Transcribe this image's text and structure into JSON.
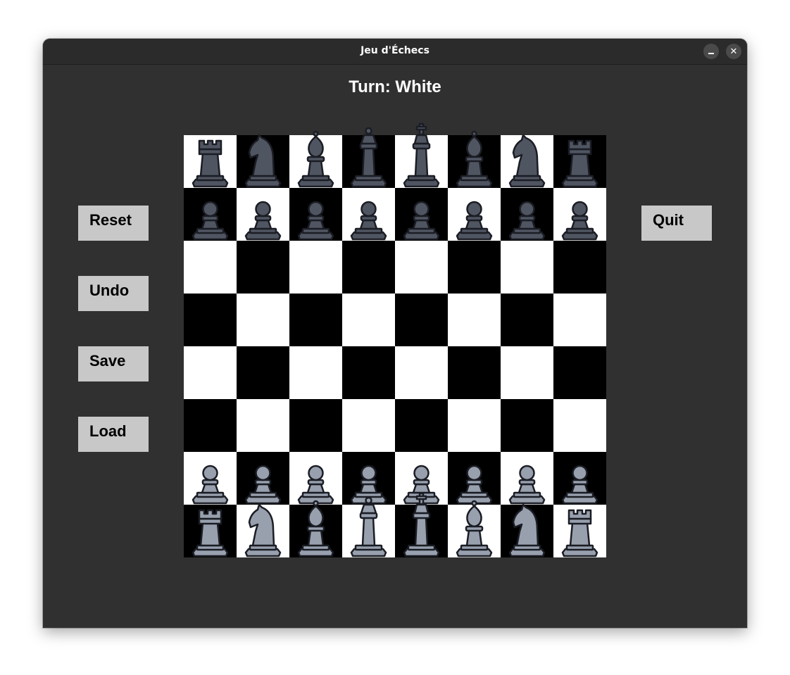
{
  "window": {
    "title": "Jeu d'Échecs",
    "minimize_icon": "minimize-icon",
    "close_icon": "close-icon",
    "close_glyph": "✕"
  },
  "turn_label": "Turn: White",
  "buttons": {
    "reset": "Reset",
    "undo": "Undo",
    "save": "Save",
    "load": "Load",
    "quit": "Quit"
  },
  "board": {
    "light_color": "#ffffff",
    "dark_color": "#000000",
    "black_piece_color": "#505562",
    "white_piece_color": "#98a0ae",
    "ranks": [
      [
        "bR",
        "bN",
        "bB",
        "bQ",
        "bK",
        "bB",
        "bN",
        "bR"
      ],
      [
        "bP",
        "bP",
        "bP",
        "bP",
        "bP",
        "bP",
        "bP",
        "bP"
      ],
      [
        "",
        "",
        "",
        "",
        "",
        "",
        "",
        ""
      ],
      [
        "",
        "",
        "",
        "",
        "",
        "",
        "",
        ""
      ],
      [
        "",
        "",
        "",
        "",
        "",
        "",
        "",
        ""
      ],
      [
        "",
        "",
        "",
        "",
        "",
        "",
        "",
        ""
      ],
      [
        "wP",
        "wP",
        "wP",
        "wP",
        "wP",
        "wP",
        "wP",
        "wP"
      ],
      [
        "wR",
        "wN",
        "wB",
        "wQ",
        "wK",
        "wB",
        "wN",
        "wR"
      ]
    ]
  },
  "piece_names": {
    "P": "pawn",
    "R": "rook",
    "N": "knight",
    "B": "bishop",
    "Q": "queen",
    "K": "king"
  }
}
